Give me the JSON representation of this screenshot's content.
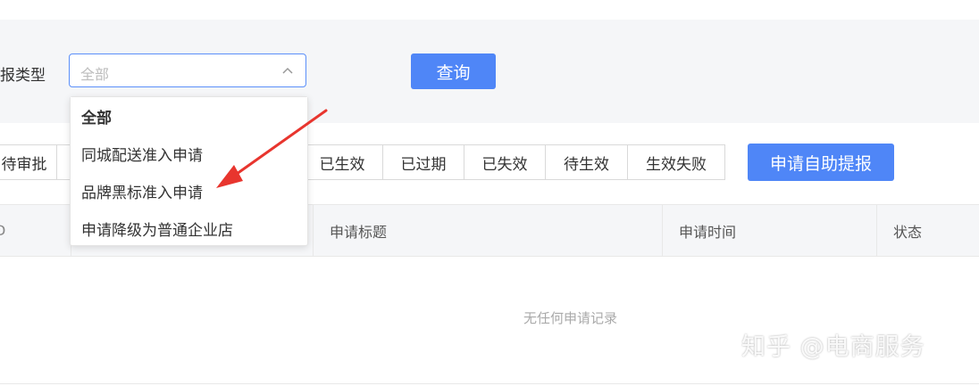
{
  "filter": {
    "label": "报类型",
    "select_value": "全部",
    "query_label": "查询"
  },
  "dropdown": {
    "options": [
      "全部",
      "同城配送准入申请",
      "品牌黑标准入申请",
      "申请降级为普通企业店"
    ],
    "selected": "全部"
  },
  "tabs": [
    "待审批",
    "已生效",
    "已过期",
    "已失效",
    "待生效",
    "生效失败"
  ],
  "apply_label": "申请自助提报",
  "table": {
    "columns": [
      "D",
      "申请标题",
      "申请时间",
      "状态"
    ],
    "empty_text": "无任何申请记录"
  },
  "watermark": "知乎 @电商服务",
  "colors": {
    "accent": "#4f86f7",
    "annotation_arrow": "#e8352e"
  }
}
